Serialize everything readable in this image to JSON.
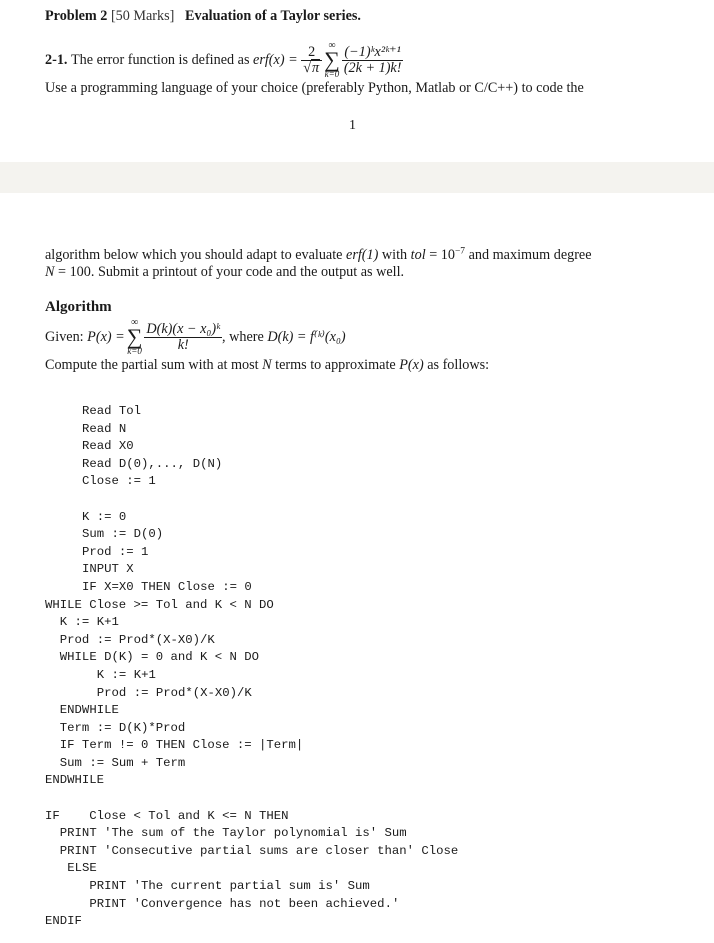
{
  "page1": {
    "problem_label": "Problem 2",
    "marks": "[50 Marks]",
    "title": "Evaluation of a Taylor series.",
    "item_label": "2-1.",
    "item_text": "The error function is defined as",
    "erf_lhs": "erf(x) =",
    "erf_coeff_num": "2",
    "erf_coeff_den": "π",
    "sum_upper": "∞",
    "sum_lower": "k=0",
    "erf_frac_num": "(−1)ᵏx²ᵏ⁺¹",
    "erf_frac_den": "(2k + 1)k!",
    "line2": "Use a programming language of your choice (preferably Python, Matlab or C/C++) to code the",
    "page_number": "1"
  },
  "page2": {
    "line1_a": "algorithm below which you should adapt to evaluate",
    "line1_erf": "erf(1)",
    "line1_b": "with",
    "line1_tol": "tol",
    "line1_c": "= 10",
    "line1_exp": "−7",
    "line1_d": "and maximum degree",
    "line2_N": "N",
    "line2_rest": "= 100. Submit a printout of your code and the output as well.",
    "algorithm_heading": "Algorithm",
    "given_label": "Given:",
    "given_lhs": "P(x) =",
    "given_num": "D(k)(x − x₀)ᵏ",
    "given_den": "k!",
    "given_where": ", where",
    "given_D": "D(k) = f⁽ᵏ⁾(x₀)",
    "compute_a": "Compute the partial sum with at most",
    "compute_N": "N",
    "compute_b": "terms to approximate",
    "compute_P": "P(x)",
    "compute_c": "as follows:"
  },
  "code_lines": [
    {
      "indent": 5,
      "text": "Read Tol"
    },
    {
      "indent": 5,
      "text": "Read N"
    },
    {
      "indent": 5,
      "text": "Read X0"
    },
    {
      "indent": 5,
      "text": "Read D(0),..., D(N)"
    },
    {
      "indent": 5,
      "text": "Close := 1"
    },
    {
      "indent": 0,
      "text": ""
    },
    {
      "indent": 5,
      "text": "K := 0"
    },
    {
      "indent": 5,
      "text": "Sum := D(0)"
    },
    {
      "indent": 5,
      "text": "Prod := 1"
    },
    {
      "indent": 5,
      "text": "INPUT X"
    },
    {
      "indent": 5,
      "text": "IF X=X0 THEN Close := 0"
    },
    {
      "indent": 0,
      "text": "WHILE Close >= Tol and K < N DO"
    },
    {
      "indent": 2,
      "text": "K := K+1"
    },
    {
      "indent": 2,
      "text": "Prod := Prod*(X-X0)/K"
    },
    {
      "indent": 2,
      "text": "WHILE D(K) = 0 and K < N DO"
    },
    {
      "indent": 7,
      "text": "K := K+1"
    },
    {
      "indent": 7,
      "text": "Prod := Prod*(X-X0)/K"
    },
    {
      "indent": 2,
      "text": "ENDWHILE"
    },
    {
      "indent": 2,
      "text": "Term := D(K)*Prod"
    },
    {
      "indent": 2,
      "text": "IF Term != 0 THEN Close := |Term|"
    },
    {
      "indent": 2,
      "text": "Sum := Sum + Term"
    },
    {
      "indent": 0,
      "text": "ENDWHILE"
    },
    {
      "indent": 0,
      "text": ""
    },
    {
      "indent": 0,
      "text": "IF    Close < Tol and K <= N THEN"
    },
    {
      "indent": 2,
      "text": "PRINT 'The sum of the Taylor polynomial is' Sum"
    },
    {
      "indent": 2,
      "text": "PRINT 'Consecutive partial sums are closer than' Close"
    },
    {
      "indent": 3,
      "text": "ELSE"
    },
    {
      "indent": 6,
      "text": "PRINT 'The current partial sum is' Sum"
    },
    {
      "indent": 6,
      "text": "PRINT 'Convergence has not been achieved.'"
    },
    {
      "indent": 0,
      "text": "ENDIF"
    }
  ]
}
